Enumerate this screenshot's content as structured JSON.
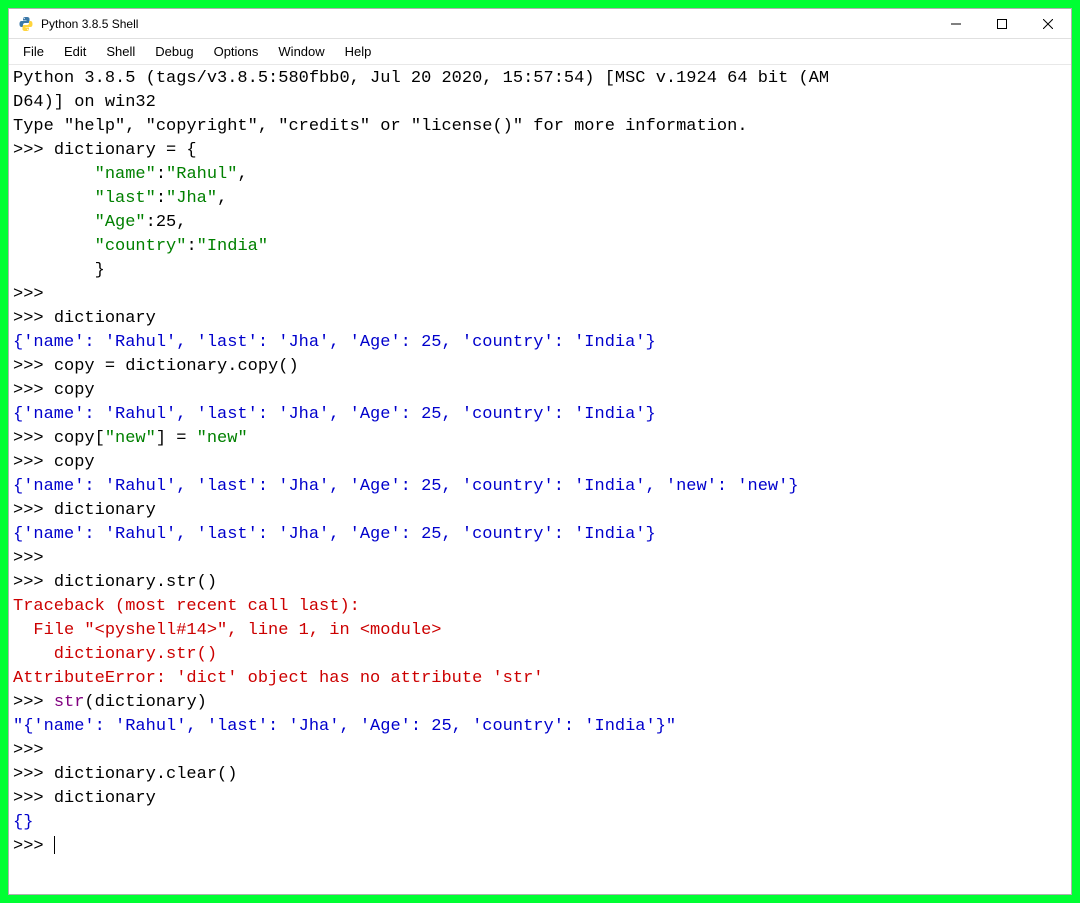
{
  "window": {
    "title": "Python 3.8.5 Shell"
  },
  "menu": {
    "file": "File",
    "edit": "Edit",
    "shell": "Shell",
    "debug": "Debug",
    "options": "Options",
    "window": "Window",
    "help": "Help"
  },
  "shell": {
    "banner1": "Python 3.8.5 (tags/v3.8.5:580fbb0, Jul 20 2020, 15:57:54) [MSC v.1924 64 bit (AM",
    "banner2": "D64)] on win32",
    "banner3": "Type \"help\", \"copyright\", \"credits\" or \"license()\" for more information.",
    "prompt": ">>> ",
    "line_dict_assign": "dictionary = {",
    "indent8": "        ",
    "key_name": "\"name\"",
    "val_rahul": "\"Rahul\"",
    "key_last": "\"last\"",
    "val_jha": "\"Jha\"",
    "key_age": "\"Age\"",
    "val_25": "25",
    "key_country": "\"country\"",
    "val_india": "\"India\"",
    "close_brace": "}",
    "colon": ":",
    "comma": ",",
    "cmd_dict": "dictionary",
    "out_dict": "{'name': 'Rahul', 'last': 'Jha', 'Age': 25, 'country': 'India'}",
    "cmd_copy_assign": "copy = dictionary.copy()",
    "cmd_copy": "copy",
    "cmd_copy_new_a": "copy[",
    "str_new": "\"new\"",
    "cmd_copy_new_b": "] = ",
    "out_copy2": "{'name': 'Rahul', 'last': 'Jha', 'Age': 25, 'country': 'India', 'new': 'new'}",
    "cmd_dict_str": "dictionary.str()",
    "tb1": "Traceback (most recent call last):",
    "tb2": "  File \"<pyshell#14>\", line 1, in <module>",
    "tb3": "    dictionary.str()",
    "tb4": "AttributeError: 'dict' object has no attribute 'str'",
    "cmd_str_a": "str",
    "cmd_str_b": "(dictionary)",
    "out_str": "\"{'name': 'Rahul', 'last': 'Jha', 'Age': 25, 'country': 'India'}\"",
    "cmd_clear": "dictionary.clear()",
    "out_empty": "{}"
  }
}
